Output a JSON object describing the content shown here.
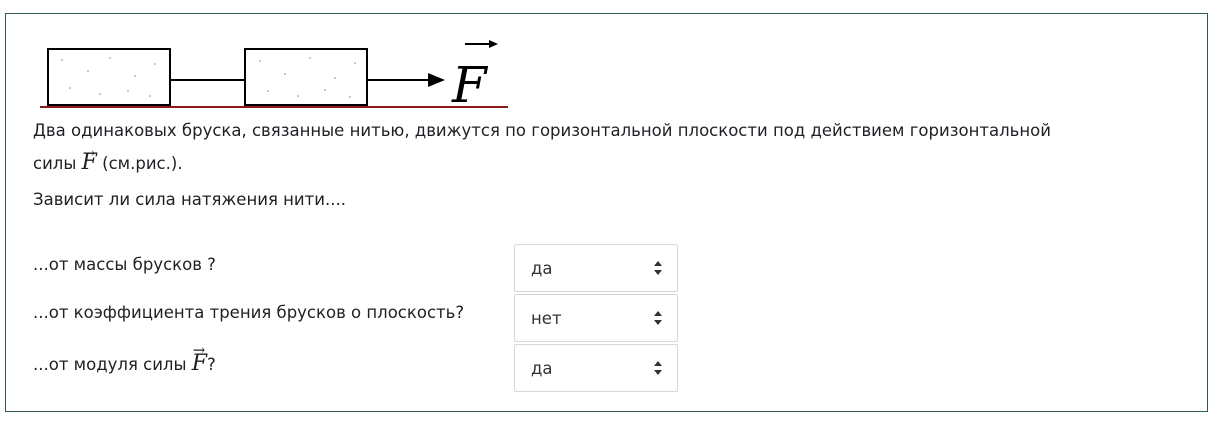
{
  "question": {
    "figure": {
      "force_symbol": "F"
    },
    "intro_line1": "Два одинаковых бруска, связанные нитью, движутся по горизонтальной плоскости под действием горизонтальной",
    "intro_line2_prefix": "силы",
    "intro_line2_force": "F",
    "intro_line2_suffix": "(см.рис.).",
    "prompt": "Зависит ли сила натяжения нити....",
    "rows": [
      {
        "label": "...от массы брусков ?",
        "selected": "да"
      },
      {
        "label": "...от коэффициента трения брусков о плоскость?",
        "selected": "нет"
      },
      {
        "label_prefix": "...от модуля силы",
        "label_force": "F",
        "label_suffix": "?",
        "selected": "да"
      }
    ]
  },
  "colors": {
    "card_border": "#2f5d56",
    "ground_line": "#8b1a1a",
    "select_border": "#d6d6d6"
  }
}
